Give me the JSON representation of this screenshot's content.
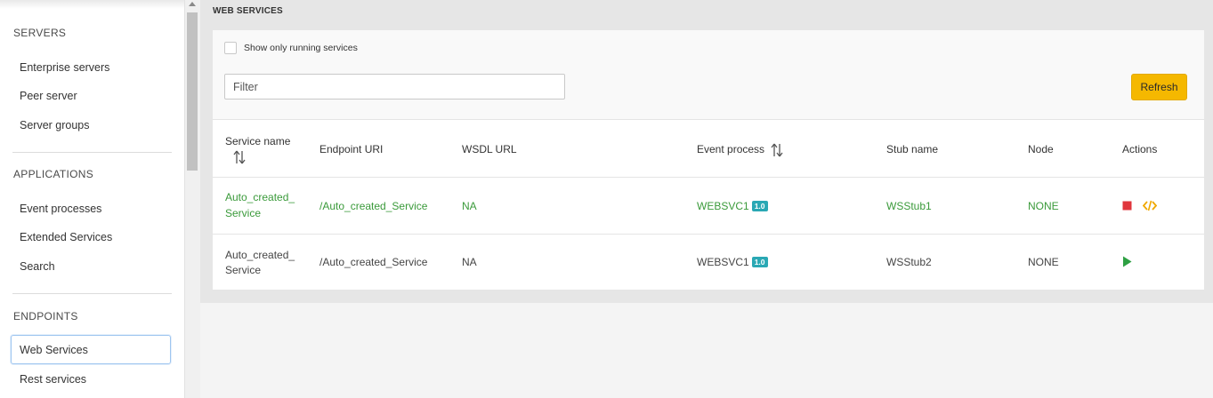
{
  "sidebar": {
    "sections": [
      {
        "title": "SERVERS",
        "items": [
          "Enterprise servers",
          "Peer server",
          "Server groups"
        ]
      },
      {
        "title": "APPLICATIONS",
        "items": [
          "Event processes",
          "Extended Services",
          "Search"
        ]
      },
      {
        "title": "ENDPOINTS",
        "items": [
          "Web Services",
          "Rest services"
        ]
      }
    ],
    "selected": "Web Services"
  },
  "main": {
    "title": "WEB SERVICES",
    "show_running_label": "Show only running services",
    "show_running_checked": false,
    "filter_placeholder": "Filter",
    "filter_value": "",
    "refresh_label": "Refresh",
    "columns": [
      "Service name",
      "Endpoint URI",
      "WSDL URL",
      "Event process",
      "Stub name",
      "Node",
      "Actions"
    ],
    "rows": [
      {
        "service_name": [
          "Auto_created_",
          "Service"
        ],
        "endpoint_uri": "/Auto_created_Service",
        "wsdl_url": "NA",
        "event_process": "WEBSVC1",
        "version": "1.0",
        "stub_name": "WSStub1",
        "node": "NONE",
        "status": "running",
        "actions": [
          "stop-icon",
          "code-icon"
        ]
      },
      {
        "service_name": [
          "Auto_created_",
          "Service"
        ],
        "endpoint_uri": "/Auto_created_Service",
        "wsdl_url": "NA",
        "event_process": "WEBSVC1",
        "version": "1.0",
        "stub_name": "WSStub2",
        "node": "NONE",
        "status": "stopped",
        "actions": [
          "play-icon"
        ]
      }
    ]
  },
  "colors": {
    "accent_yellow": "#f5b800",
    "running_green": "#3a9a3a",
    "stop_red": "#e0363c",
    "code_orange": "#f0a800",
    "badge_teal": "#2aa8b4",
    "play_green": "#2ea043"
  }
}
